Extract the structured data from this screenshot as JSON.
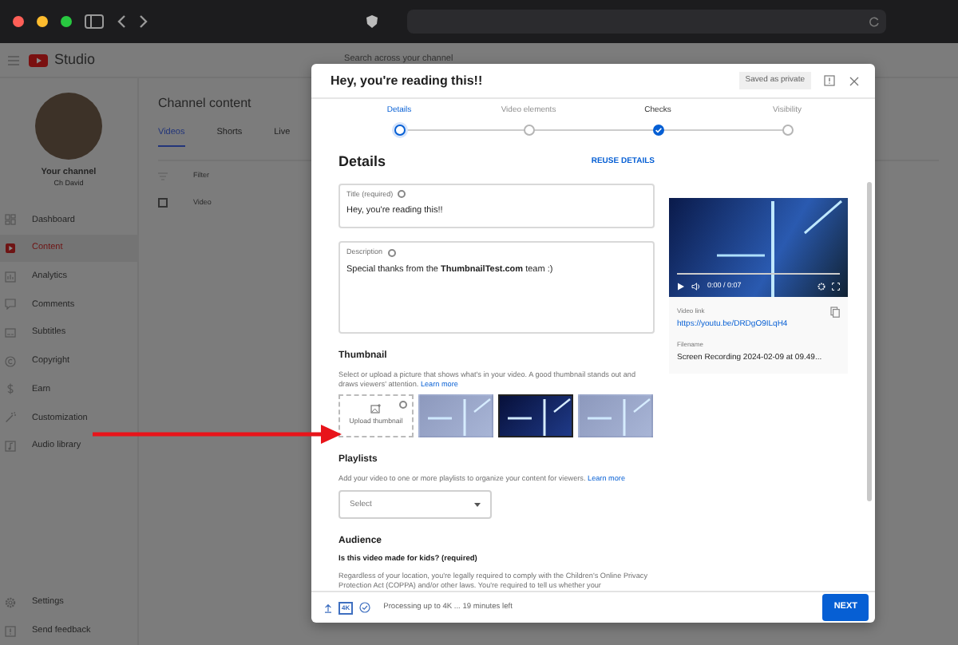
{
  "studio": {
    "logo": "Studio",
    "search_placeholder": "Search across your channel",
    "channel": {
      "name": "Your channel",
      "handle": "Ch David"
    },
    "nav": [
      {
        "label": "Dashboard",
        "selected": false
      },
      {
        "label": "Content",
        "selected": true
      },
      {
        "label": "Analytics",
        "selected": false
      },
      {
        "label": "Comments",
        "selected": false
      },
      {
        "label": "Subtitles",
        "selected": false
      },
      {
        "label": "Copyright",
        "selected": false
      },
      {
        "label": "Earn",
        "selected": false
      },
      {
        "label": "Customization",
        "selected": false
      },
      {
        "label": "Audio library",
        "selected": false
      }
    ],
    "footer_nav": [
      "Settings",
      "Send feedback"
    ]
  },
  "content": {
    "title": "Channel content",
    "tabs": [
      {
        "label": "Videos",
        "selected": true
      },
      {
        "label": "Shorts",
        "selected": false
      },
      {
        "label": "Live",
        "selected": false
      }
    ],
    "filter": "Filter",
    "select_all": {
      "checked": false
    },
    "column": "Video"
  },
  "dialog": {
    "title": "Hey, you're reading this!!",
    "saved": "Saved as private",
    "steps": [
      {
        "label": "Details",
        "selected": true,
        "done": false
      },
      {
        "label": "Video elements",
        "selected": false,
        "done": false
      },
      {
        "label": "Checks",
        "selected": false,
        "done": true
      },
      {
        "label": "Visibility",
        "selected": false,
        "done": false
      }
    ],
    "heading": "Details",
    "reuse": "REUSE DETAILS",
    "title_field": {
      "label": "Title (required)",
      "value": "Hey, you're reading this!!"
    },
    "description_field": {
      "label": "Description",
      "value": "Special thanks from the **ThumbnailTest.com** team :)"
    },
    "video": {
      "time": "0:00 / 0:07",
      "link_label": "Video link",
      "link": "https://youtu.be/DRDgO9ILqH4",
      "filename_label": "Filename",
      "filename": "Screen Recording 2024-02-09 at 09.49..."
    },
    "thumbnail": {
      "heading": "Thumbnail",
      "text": "Select or upload a picture that shows what's in your video. A good thumbnail stands out and draws viewers' attention.",
      "learn_more": "Learn more",
      "upload": "Upload thumbnail",
      "options": [
        {
          "selected": false
        },
        {
          "selected": true
        },
        {
          "selected": false
        }
      ]
    },
    "playlists": {
      "heading": "Playlists",
      "text": "Add your video to one or more playlists to organize your content for viewers.",
      "learn_more": "Learn more",
      "select": "Select"
    },
    "audience": {
      "heading": "Audience",
      "question": "Is this video made for kids? (required)",
      "text": "Regardless of your location, you're legally required to comply with the Children's Online Privacy Protection Act (COPPA) and/or other laws. You're required to tell us whether your"
    },
    "footer": {
      "quality": "4K",
      "status": "Processing up to 4K ... 19 minutes left",
      "next": "NEXT"
    }
  }
}
